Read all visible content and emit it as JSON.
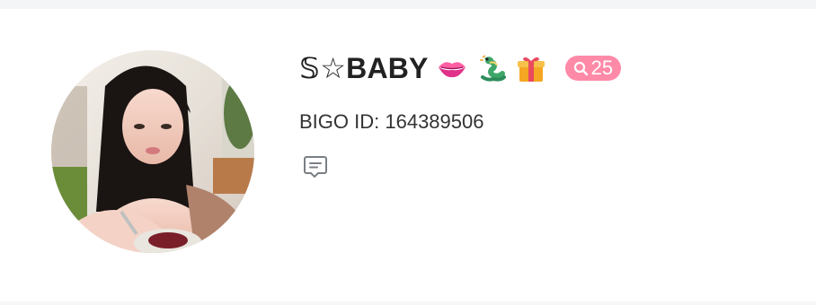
{
  "profile": {
    "name": "𝕊☆BABY",
    "avatar_alt": "profile avatar",
    "emojis": [
      "kiss-mark",
      "dragon",
      "gift"
    ],
    "level_badge": {
      "icon": "search-icon",
      "value": "25",
      "color": "#ff8aa7"
    },
    "id_label": "BIGO ID: ",
    "id_value": "164389506",
    "message_icon": "message-icon"
  }
}
